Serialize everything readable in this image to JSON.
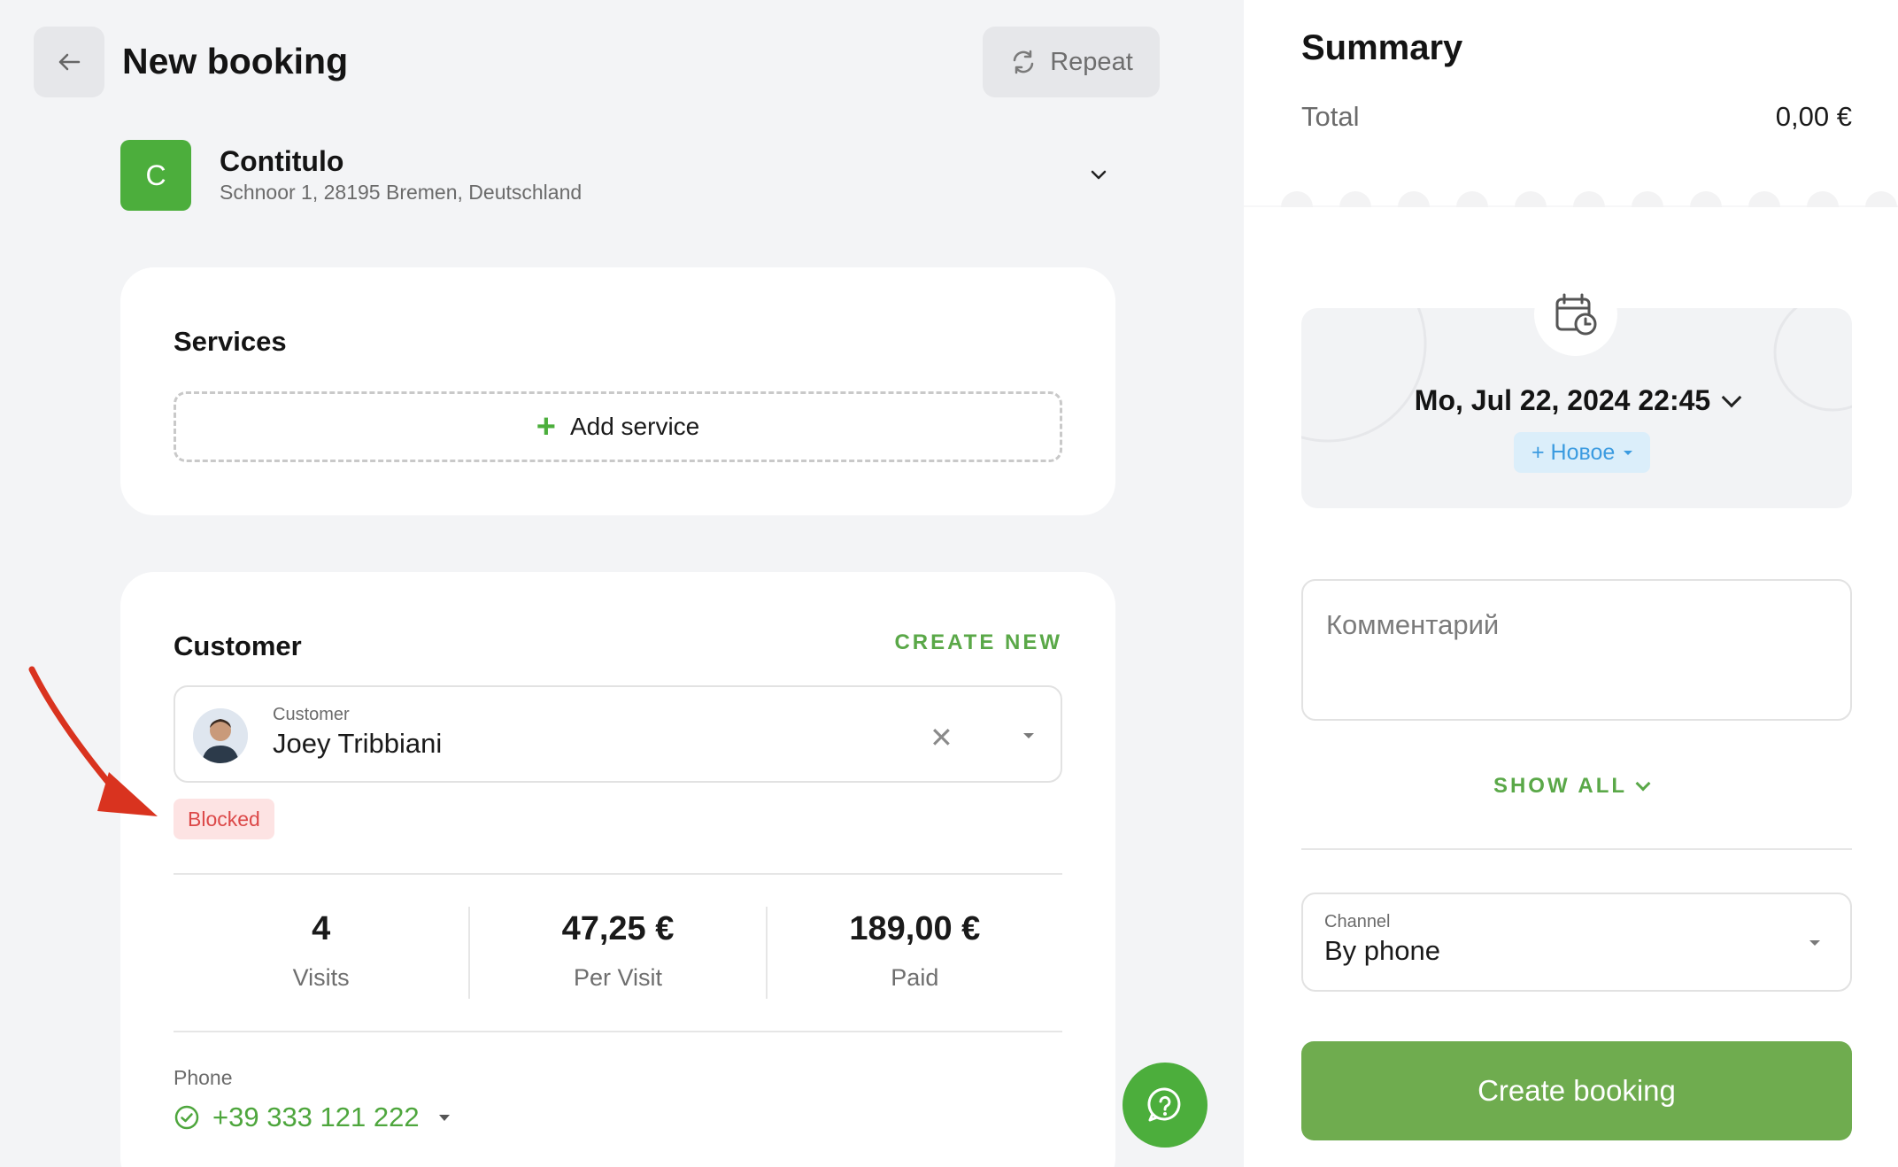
{
  "header": {
    "title": "New booking",
    "repeat_label": "Repeat"
  },
  "location": {
    "initial": "C",
    "name": "Contitulo",
    "address": "Schnoor 1, 28195 Bremen, Deutschland"
  },
  "services": {
    "title": "Services",
    "add_label": "Add service"
  },
  "customer": {
    "title": "Customer",
    "create_new": "CREATE NEW",
    "field_label": "Customer",
    "name": "Joey Tribbiani",
    "status_badge": "Blocked",
    "stats": [
      {
        "value": "4",
        "label": "Visits"
      },
      {
        "value": "47,25 €",
        "label": "Per Visit"
      },
      {
        "value": "189,00 €",
        "label": "Paid"
      }
    ],
    "phone_label": "Phone",
    "phone": "+39 333 121 222"
  },
  "summary": {
    "title": "Summary",
    "total_label": "Total",
    "total_value": "0,00 €",
    "date": "Mo, Jul 22, 2024 22:45",
    "status_chip": "+ Новое",
    "comment_placeholder": "Комментарий",
    "show_all": "SHOW ALL",
    "channel_label": "Channel",
    "channel_value": "By phone",
    "create_label": "Create booking"
  },
  "colors": {
    "brand_green": "#4cae3c",
    "button_green": "#6fac4f",
    "blocked_bg": "#fde3e3",
    "blocked_text": "#dc4848",
    "chip_blue": "#3b9be0"
  },
  "icons": [
    "arrow-left-icon",
    "repeat-icon",
    "chevron-down-icon",
    "plus-icon",
    "close-icon",
    "caret-down-icon",
    "check-circle-icon",
    "help-chat-icon",
    "calendar-clock-icon"
  ]
}
